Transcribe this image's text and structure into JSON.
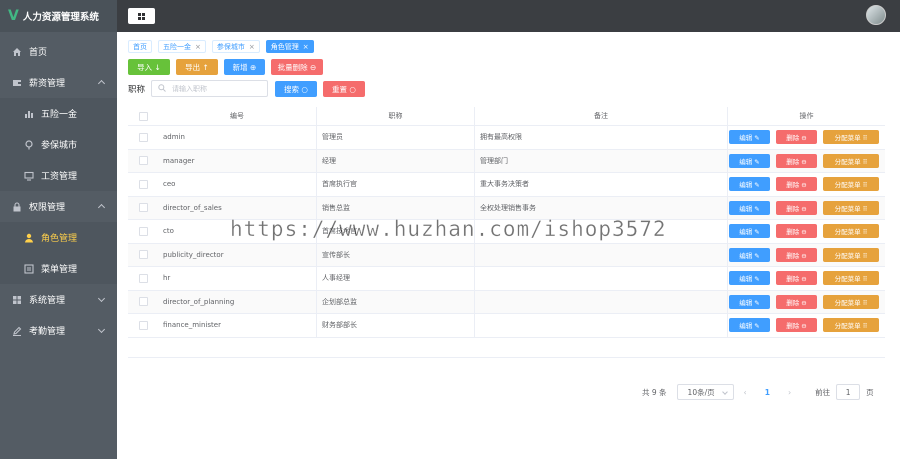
{
  "app": {
    "title": "人力资源管理系统",
    "logo_letter": "V"
  },
  "sidebar": {
    "items": [
      {
        "label": "首页",
        "icon": "home-icon",
        "type": "top"
      },
      {
        "label": "薪资管理",
        "icon": "wallet-icon",
        "type": "top",
        "expanded": true
      },
      {
        "label": "五险一金",
        "icon": "bar-chart-icon",
        "type": "sub"
      },
      {
        "label": "参保城市",
        "icon": "location-icon",
        "type": "sub"
      },
      {
        "label": "工资管理",
        "icon": "monitor-icon",
        "type": "sub"
      },
      {
        "label": "权限管理",
        "icon": "lock-icon",
        "type": "top",
        "expanded": true
      },
      {
        "label": "角色管理",
        "icon": "user-icon",
        "type": "sub",
        "active": true
      },
      {
        "label": "菜单管理",
        "icon": "menu-icon",
        "type": "sub"
      },
      {
        "label": "系统管理",
        "icon": "grid-icon",
        "type": "top"
      },
      {
        "label": "考勤管理",
        "icon": "edit-icon",
        "type": "top"
      }
    ]
  },
  "tags": [
    {
      "label": "首页",
      "closable": false
    },
    {
      "label": "五险一金",
      "closable": true
    },
    {
      "label": "参保城市",
      "closable": true
    },
    {
      "label": "角色管理",
      "closable": true,
      "current": true
    }
  ],
  "toolbar": {
    "import": "导入 ↓",
    "export": "导出 ↑",
    "add": "新增 ⊕",
    "batch_delete": "批量删除 ⊖"
  },
  "search": {
    "label": "职称",
    "placeholder": "请输入职称",
    "search_button": "搜索 ○",
    "reset_button": "重置 ○"
  },
  "table": {
    "headers": [
      "编号",
      "职称",
      "备注",
      "操作"
    ],
    "rows": [
      {
        "code": "admin",
        "title": "管理员",
        "remark": "拥有最高权限"
      },
      {
        "code": "manager",
        "title": "经理",
        "remark": "管理部门"
      },
      {
        "code": "ceo",
        "title": "首席执行官",
        "remark": "重大事务决策者"
      },
      {
        "code": "director_of_sales",
        "title": "销售总监",
        "remark": "全权处理销售事务"
      },
      {
        "code": "cto",
        "title": "首席技术官",
        "remark": ""
      },
      {
        "code": "publicity_director",
        "title": "宣传部长",
        "remark": ""
      },
      {
        "code": "hr",
        "title": "人事经理",
        "remark": ""
      },
      {
        "code": "director_of_planning",
        "title": "企划部总监",
        "remark": ""
      },
      {
        "code": "finance_minister",
        "title": "财务部部长",
        "remark": ""
      }
    ],
    "actions": {
      "edit": "编辑 ✎",
      "delete": "删除 ⊖",
      "assign": "分配菜单 ⠿"
    }
  },
  "pagination": {
    "total": "共 9 条",
    "page_size": "10条/页",
    "prev": "‹",
    "current": "1",
    "next": "›",
    "goto_label": "前往",
    "goto_value": "1",
    "page_suffix": "页"
  },
  "watermark": "https://www.huzhan.com/ishop3572",
  "colors": {
    "sidebar_bg": "#545c64",
    "header_bg": "#3b3e42",
    "primary": "#409eff",
    "success": "#67c23a",
    "warning": "#e6a23c",
    "danger": "#f56c6c",
    "active_menu": "#ffd04b"
  }
}
